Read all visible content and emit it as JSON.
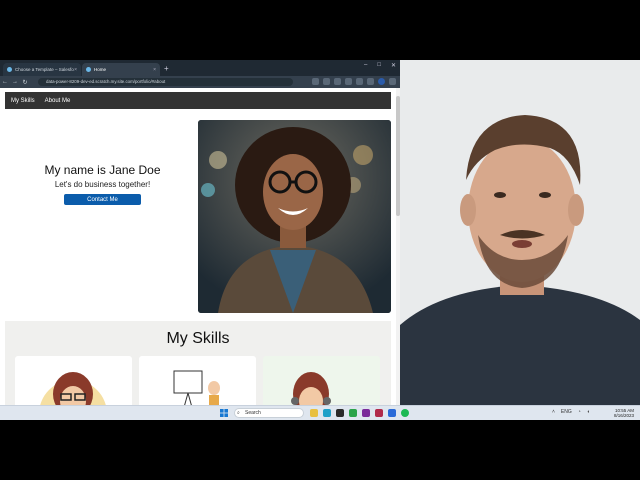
{
  "browser": {
    "tabs": [
      {
        "label": "Choose a Template – Salesforce"
      },
      {
        "label": "Home"
      }
    ],
    "new_tab": "+",
    "url": "data-power-8209-dev-ed.scratch.my.site.com/portfolio/#about"
  },
  "site": {
    "nav": [
      "My Skills",
      "About Me"
    ],
    "hero_title": "My name is Jane Doe",
    "hero_subtitle": "Let's do business together!",
    "contact_button": "Contact Me",
    "skills_title": "My Skills"
  },
  "taskbar": {
    "search_placeholder": "Search",
    "language": "ENG",
    "time": "10:55 AM",
    "date": "8/16/2023"
  },
  "colors": {
    "accent_button": "#0b5cab",
    "nav_bar": "#333333",
    "browser_chrome": "#1f2933"
  }
}
